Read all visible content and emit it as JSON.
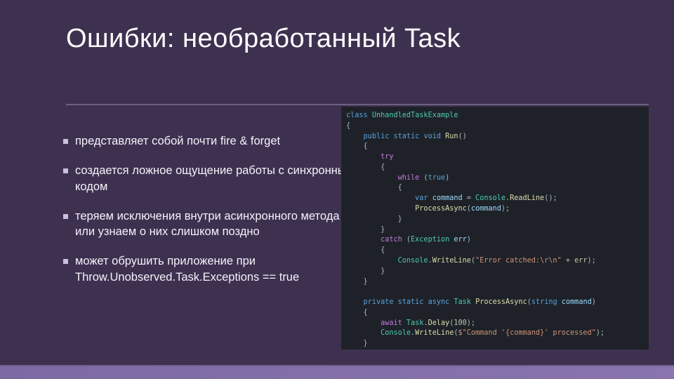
{
  "title": "Ошибки: необработанный Task",
  "bullets": [
    "представляет собой почти fire & forget",
    "создается ложное ощущение работы с синхронным кодом",
    "теряем исключения внутри асинхронного метода или узнаем о них слишком поздно",
    "может обрушить приложение при Throw.Unobserved.Task.Exceptions == true"
  ],
  "code": {
    "class_decl_kw": "class",
    "class_name": "UnhandledTaskExample",
    "public": "public",
    "static": "static",
    "void": "void",
    "run": "Run",
    "try": "try",
    "while": "while",
    "true": "true",
    "var": "var",
    "command": "command",
    "console": "Console",
    "readline": "ReadLine",
    "processasync": "ProcessAsync",
    "catch": "catch",
    "exception": "Exception",
    "err": "err",
    "writeline": "WriteLine",
    "err_string": "\"Error catched:\\r\\n\"",
    "plus_err": " + err",
    "private": "private",
    "async": "async",
    "task": "Task",
    "string": "string",
    "await": "await",
    "delay": "Delay",
    "delay_n": "100",
    "interp": "$\"Command '{command}' processed\""
  }
}
